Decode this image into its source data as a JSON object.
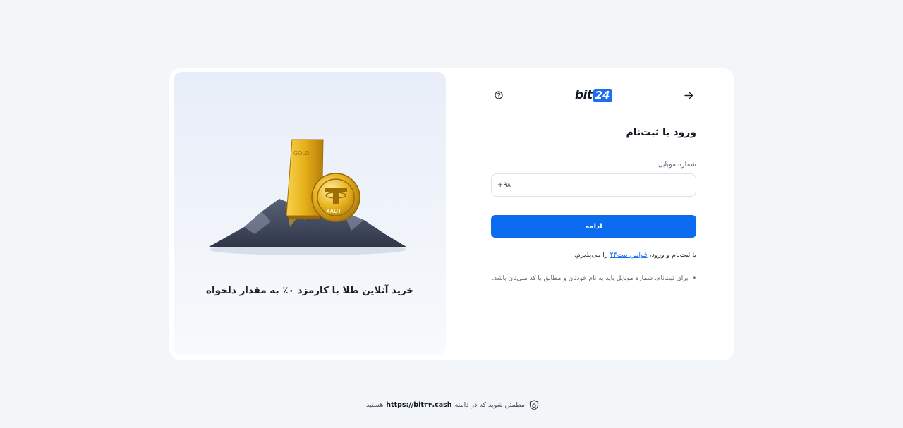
{
  "promo": {
    "tagline": "خرید آنلاین طلا با کارمزد ۰٪ به مقدار دلخواه",
    "gold_bar_label": "GOLD",
    "coin_label": "XAUT"
  },
  "header": {
    "logo_text": "bit",
    "logo_number": "24",
    "help_icon": "question-circle-icon",
    "back_icon": "arrow-right-icon"
  },
  "form": {
    "title": "ورود یا ثبت‌نام",
    "phone_label": "شماره موبایل",
    "phone_value": "+۹۸",
    "continue_label": "ادامه",
    "terms_prefix": "با ثبت‌نام و ورود، ",
    "terms_link": "قوانین بیت۲۴",
    "terms_suffix": " را می‌پذیرم.",
    "note": "برای ثبت‌نام، شماره موبایل باید به نام خودتان و مطابق با کد ملی‌تان باشد."
  },
  "footer": {
    "text_before": "مطمئن شوید که در دامنه",
    "domain": "https://bit۲۴.cash",
    "text_after": "هستید.",
    "icon": "shield-lock-icon"
  },
  "colors": {
    "primary": "#0b6cf0",
    "background": "#f3f6f9",
    "card": "#ffffff"
  }
}
